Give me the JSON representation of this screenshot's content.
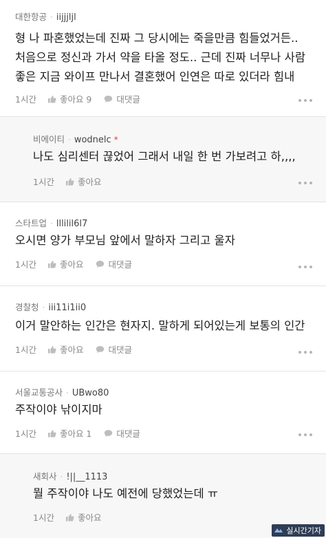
{
  "comments": [
    {
      "company": "대한항공",
      "user": "iijjjljl",
      "text": "형 나 파혼했었는데 진짜 그 당시에는 죽을만큼 힘들었거든..\n처음으로 정신과 가서 약을 타올 정도.. 근데 진짜 너무나 사람\n좋은 지금 와이프 만나서 결혼했어 인연은 따로 있더라 힘내",
      "time": "1시간",
      "like": "좋아요 9",
      "reply": "대댓글"
    },
    {
      "company": "비에이티",
      "user": "wodnelc",
      "marker": "*",
      "text": "나도 심리센터 끊었어 그래서 내일 한 번 가보려고 하,,,,",
      "time": "1시간",
      "like": "좋아요"
    },
    {
      "company": "스타트업",
      "user": "lllilil6l7",
      "text": "오시면 양가 부모님 앞에서 말하자 그리고 울자",
      "time": "1시간",
      "like": "좋아요",
      "reply": "대댓글"
    },
    {
      "company": "경찰청",
      "user": "iii11i1ii0",
      "text": "이거 말안하는 인간은 현자지. 말하게 되어있는게 보통의 인간",
      "time": "1시간",
      "like": "좋아요",
      "reply": "대댓글"
    },
    {
      "company": "서울교통공사",
      "user": "UBwo80",
      "text": "주작이야 낚이지마",
      "time": "1시간",
      "like": "좋아요 1",
      "reply": "대댓글"
    },
    {
      "company": "새회사",
      "user": "!||__1113",
      "text": "뭘 주작이야 나도 예전에 당했었는데 ㅠ",
      "time": "1시간",
      "like": "좋아요"
    }
  ],
  "watermark": "실시간기자",
  "icons": {
    "like": "thumbs-up-icon",
    "reply": "speech-bubble-icon",
    "more": "more-dots-icon"
  }
}
